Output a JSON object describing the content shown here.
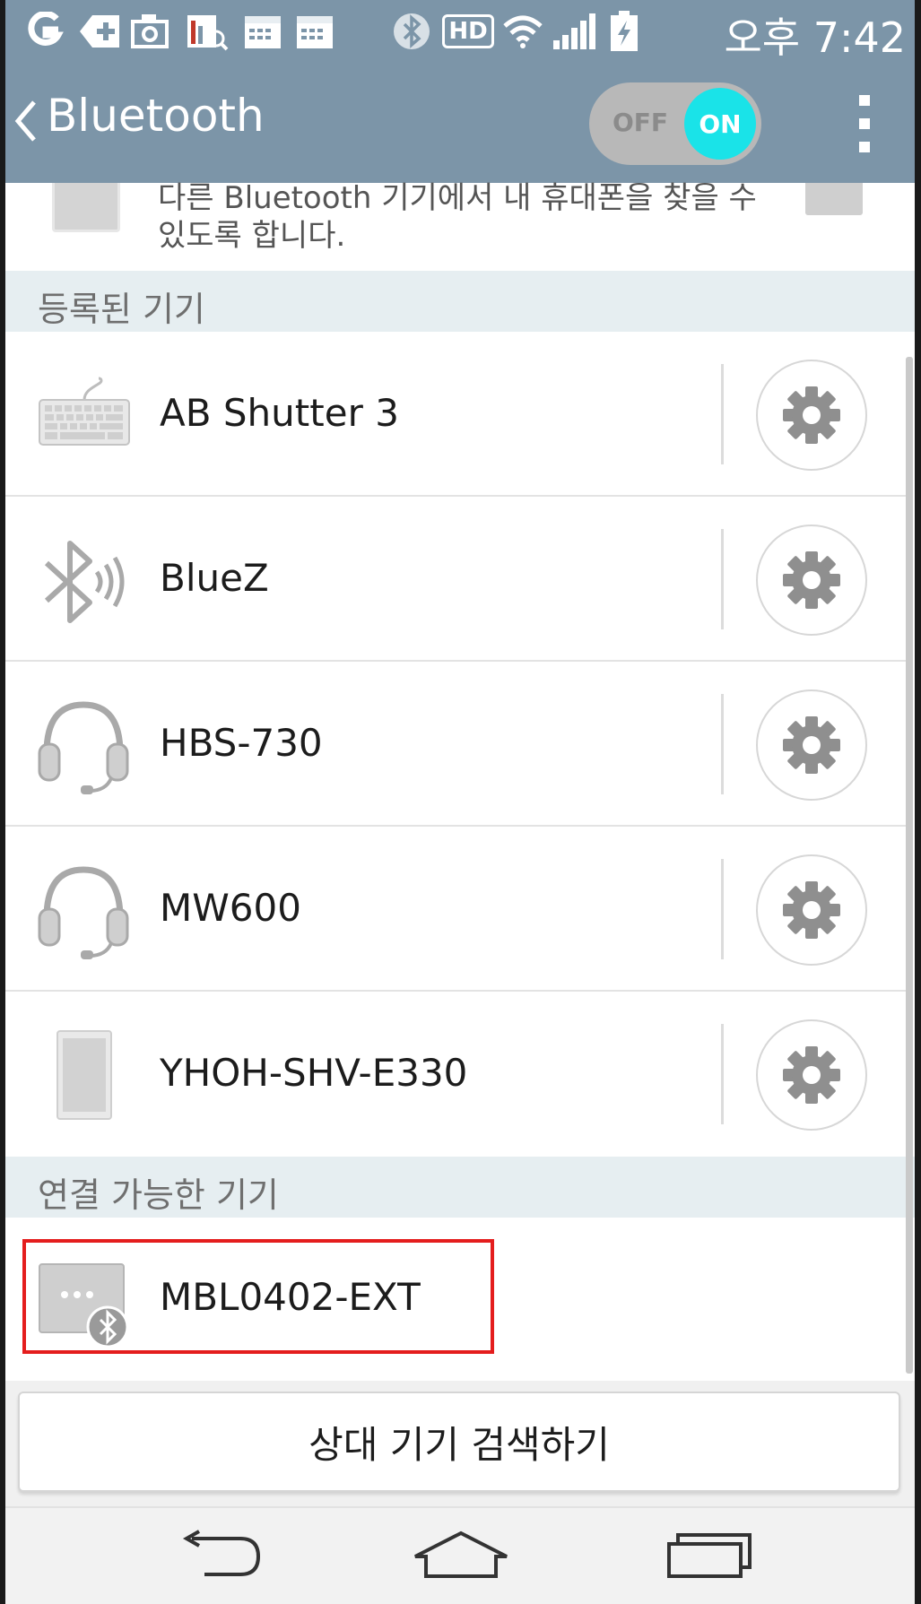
{
  "status_bar": {
    "time": "오후 7:42",
    "hd_label": "HD",
    "icons": [
      "g-app-icon",
      "add-icon",
      "camera-icon",
      "gallery-search-icon",
      "calendar-icon",
      "calendar-icon",
      "bluetooth-icon",
      "hd-icon",
      "wifi-icon",
      "signal-icon",
      "battery-charging-icon"
    ]
  },
  "action_bar": {
    "title": "Bluetooth",
    "toggle_off_label": "OFF",
    "toggle_on_label": "ON",
    "toggle_state": "on"
  },
  "visibility": {
    "description": "다른 Bluetooth 기기에서 내 휴대폰을 찾을 수 있도록 합니다."
  },
  "paired_section": {
    "header": "등록된 기기",
    "devices": [
      {
        "name": "AB Shutter 3",
        "icon": "keyboard-icon"
      },
      {
        "name": "BlueZ",
        "icon": "bluetooth-audio-icon"
      },
      {
        "name": "HBS-730",
        "icon": "headset-icon"
      },
      {
        "name": "MW600",
        "icon": "headset-icon"
      },
      {
        "name": "YHOH-SHV-E330",
        "icon": "phone-icon"
      }
    ]
  },
  "available_section": {
    "header": "연결 가능한 기기",
    "devices": [
      {
        "name": "MBL0402-EXT",
        "icon": "bluetooth-device-icon"
      }
    ]
  },
  "search_button": {
    "label": "상대 기기 검색하기"
  },
  "colors": {
    "status_bar": "#7c95a8",
    "toggle_on": "#1ae3e8",
    "section_header_bg": "#e6eef1",
    "highlight": "#e41d1d"
  }
}
